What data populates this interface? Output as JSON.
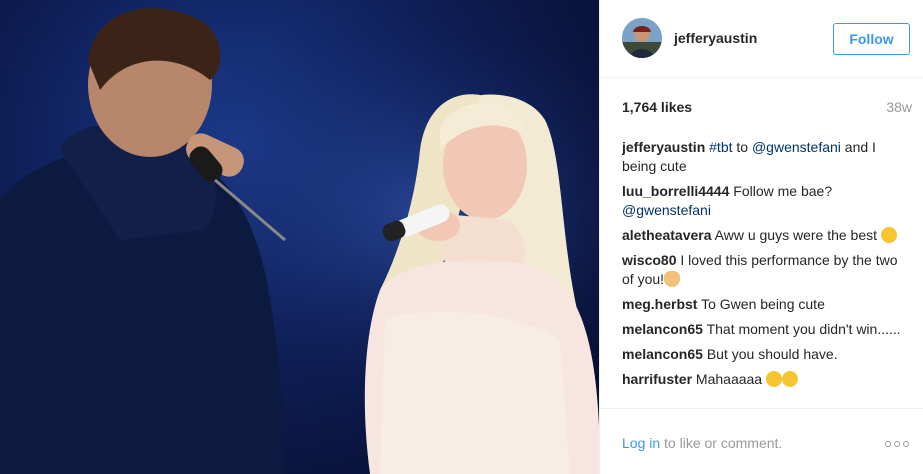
{
  "header": {
    "username": "jefferyaustin",
    "follow_label": "Follow"
  },
  "stats": {
    "likes": "1,764 likes",
    "age": "38w"
  },
  "comments": [
    {
      "user": "jefferyaustin",
      "parts": [
        {
          "t": "link",
          "v": "#tbt"
        },
        {
          "t": "text",
          "v": " to "
        },
        {
          "t": "link",
          "v": "@gwenstefani"
        },
        {
          "t": "text",
          "v": " and I being cute"
        }
      ]
    },
    {
      "user": "luu_borrelli4444",
      "parts": [
        {
          "t": "text",
          "v": "Follow me bae? "
        },
        {
          "t": "link",
          "v": "@gwenstefani"
        }
      ]
    },
    {
      "user": "aletheatavera",
      "parts": [
        {
          "t": "text",
          "v": "Aww u guys were the best "
        },
        {
          "t": "emoji",
          "v": "smile"
        }
      ]
    },
    {
      "user": "wisco80",
      "parts": [
        {
          "t": "text",
          "v": "I loved this performance by the two of you!"
        },
        {
          "t": "emoji",
          "v": "ok-hand"
        }
      ]
    },
    {
      "user": "meg.herbst",
      "parts": [
        {
          "t": "text",
          "v": "To Gwen being cute"
        }
      ]
    },
    {
      "user": "melancon65",
      "parts": [
        {
          "t": "text",
          "v": "That moment you didn't win......"
        }
      ]
    },
    {
      "user": "melancon65",
      "parts": [
        {
          "t": "text",
          "v": "But you should have."
        }
      ]
    },
    {
      "user": "harrifuster",
      "parts": [
        {
          "t": "text",
          "v": "Mahaaaaa "
        },
        {
          "t": "emoji",
          "v": "smile"
        },
        {
          "t": "emoji",
          "v": "smile"
        }
      ]
    }
  ],
  "footer": {
    "login_link": "Log in",
    "login_rest": " to like or comment."
  },
  "icons": {
    "more": "more-options-icon"
  }
}
